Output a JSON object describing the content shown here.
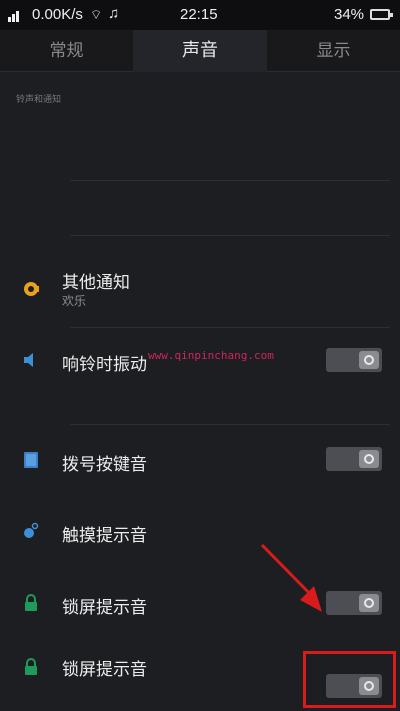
{
  "status_bar": {
    "net_speed": "0.00K/s",
    "time": "22:15",
    "battery": "34%"
  },
  "tabs": [
    "常规",
    "声音",
    "显示"
  ],
  "active_tab": "声音",
  "section_title": "铃声和通知",
  "rows": {
    "other_notify": {
      "label": "其他通知",
      "sub": "欢乐",
      "icon": "notification-sound-icon"
    },
    "ring_vibrate": {
      "label": "响铃时振动",
      "icon": "speaker-icon",
      "toggle": "off"
    },
    "dial_tone": {
      "label": "拨号按键音",
      "icon": "dialpad-icon",
      "toggle": "off"
    },
    "touch_tone": {
      "label": "触摸提示音",
      "icon": "touch-icon"
    },
    "lock_tone": {
      "label": "锁屏提示音",
      "icon": "lock-icon",
      "toggle": "off"
    },
    "lock_tone_2": {
      "label": "锁屏提示音",
      "icon": "lock-icon",
      "toggle": "off"
    }
  },
  "watermark": "www.qinpinchang.com",
  "colors": {
    "background": "#1d1e22",
    "icon_orange": "#e8a21f",
    "icon_blue": "#3d8fd8",
    "icon_green": "#1f9a5a",
    "annotation_red": "#d81b1b",
    "watermark": "#d0245a"
  }
}
